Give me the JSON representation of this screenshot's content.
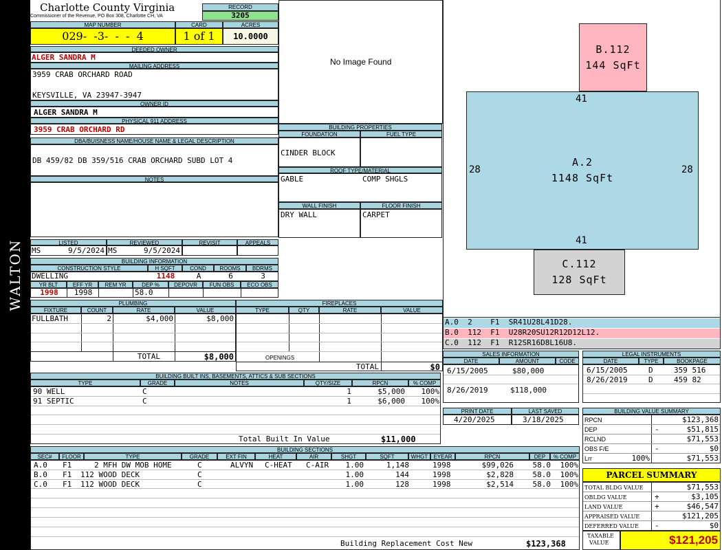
{
  "sidebar": {
    "district": "WALTON"
  },
  "header": {
    "county": "Charlotte County Virginia",
    "commissioner": "Commissioner of the Revenue, PO Box 308, Charlotte CH, VA",
    "record_label": "RECORD",
    "record": "3205",
    "map_label": "MAP NUMBER",
    "map_number": "029-  -3-  -  -  4",
    "card_label": "CARD",
    "card": "1 of 1",
    "acres_label": "ACRES",
    "acres": "10.0000"
  },
  "owner": {
    "deeded_label": "DEEDED OWNER",
    "deeded": "ALGER SANDRA M",
    "mailing_label": "MAILING ADDRESS",
    "addr1": "3959 CRAB ORCHARD ROAD",
    "addr2": "KEYSVILLE, VA 23947-3947",
    "owner_id_label": "OWNER ID",
    "owner_id": "ALGER SANDRA M",
    "phys_label": "PHYSICAL 911 ADDRESS",
    "phys": "3959 CRAB ORCHARD RD",
    "dba_label": "DBA/BUISNESS NAME/HOUSE NAME & LEGAL DESCRIPTION",
    "legal": "DB 459/82 DB 359/516 CRAB ORCHARD SUBD LOT 4",
    "notes_label": "NOTES"
  },
  "image": {
    "placeholder": "No Image Found"
  },
  "props": {
    "title": "BUILDING PROPERTIES",
    "foundation_label": "FOUNDATION",
    "fuel_label": "FUEL TYPE",
    "foundation": "CINDER BLOCK",
    "roof_label": "ROOF TYPE/MATERIAL",
    "roof_type": "GABLE",
    "roof_mat": "COMP SHGLS",
    "wall_label": "WALL FINISH",
    "floor_label": "FLOOR FINISH",
    "wall": "DRY WALL",
    "floor": "CARPET"
  },
  "listing": {
    "listed_label": "LISTED",
    "reviewed_label": "REVIEWED",
    "revisit_label": "REVISIT",
    "appeals_label": "APPEALS",
    "listed_by": "MS",
    "listed_date": "9/5/2024",
    "reviewed_by": "MS",
    "reviewed_date": "9/5/2024"
  },
  "bldg": {
    "title": "BUILDING INFORMATION",
    "style_label": "CONSTRUCTION STYLE",
    "hsqft_label": "H SQFT",
    "cond_label": "COND",
    "rooms_label": "ROOMS",
    "bdrms_label": "BDRMS",
    "style": "DWELLING",
    "hsqft": "1148",
    "cond": "A",
    "rooms": "6",
    "bdrms": "3",
    "yrblt_label": "YR BLT",
    "effyr_label": "EFF YR",
    "remyr_label": "REM YR",
    "dep_label": "DEP %",
    "depovr_label": "DEPOVR",
    "funobs_label": "FUN OBS",
    "ecoobs_label": "ECO OBS",
    "yrblt": "1998",
    "effyr": "1998",
    "dep": "58.0"
  },
  "plumbing": {
    "title": "PLUMBING",
    "h_fixture": "FIXTURE",
    "h_count": "COUNT",
    "h_rate": "RATE",
    "h_value": "VALUE",
    "fixture": "FULLBATH",
    "count": "2",
    "rate": "$4,000",
    "value": "$8,000",
    "total_label": "TOTAL",
    "total": "$8,000"
  },
  "fireplaces": {
    "title": "FIREPLACES",
    "h_type": "TYPE",
    "h_qty": "QTY",
    "h_rate": "RATE",
    "h_value": "VALUE",
    "openings_label": "OPENINGS",
    "total_label": "TOTAL",
    "total": "$0"
  },
  "builtins": {
    "title": "BUILDING BUILT INS, BASEMENTS, ATTICS & SUB SECTIONS",
    "h_type": "TYPE",
    "h_grade": "GRADE",
    "h_notes": "NOTES",
    "h_qty": "QTY/SIZE",
    "h_rpcn": "RPCN",
    "h_comp": "% COMP",
    "rows": [
      {
        "type": "90 WELL",
        "grade": "C",
        "qty": "1",
        "rpcn": "$5,000",
        "comp": "100%"
      },
      {
        "type": "91 SEPTIC",
        "grade": "C",
        "qty": "1",
        "rpcn": "$6,000",
        "comp": "100%"
      }
    ],
    "total_label": "Total Built In Value",
    "total": "$11,000"
  },
  "sections": {
    "title": "BUILDING SECTIONS",
    "h_sec": "SEC#",
    "h_floor": "FLOOR",
    "h_type": "TYPE",
    "h_grade": "GRADE",
    "h_extfin": "EXT FIN",
    "h_heat": "HEAT",
    "h_air": "AIR",
    "h_shgt": "SHGT",
    "h_sqft": "SQFT",
    "h_whgt": "WHGT",
    "h_eyear": "EYEAR",
    "h_rpcn": "RPCN",
    "h_dep": "DEP",
    "h_comp": "% COMP",
    "rows": [
      {
        "sec": "A.0",
        "floor": "F1",
        "type": "2 MFH DW MOB HOME",
        "grade": "C",
        "extfin": "ALVYN",
        "heat": "C-HEAT",
        "air": "C-AIR",
        "shgt": "1.00",
        "sqft": "1,148",
        "eyear": "1998",
        "rpcn": "$99,026",
        "dep": "58.0",
        "comp": "100%"
      },
      {
        "sec": "B.0",
        "floor": "F1",
        "type": "112 WOOD DECK",
        "grade": "C",
        "extfin": "",
        "heat": "",
        "air": "",
        "shgt": "1.00",
        "sqft": "144",
        "eyear": "1998",
        "rpcn": "$2,828",
        "dep": "58.0",
        "comp": "100%"
      },
      {
        "sec": "C.0",
        "floor": "F1",
        "type": "112 WOOD DECK",
        "grade": "C",
        "extfin": "",
        "heat": "",
        "air": "",
        "shgt": "1.00",
        "sqft": "128",
        "eyear": "1998",
        "rpcn": "$2,514",
        "dep": "58.0",
        "comp": "100%"
      }
    ],
    "rcn_label": "Building Replacement Cost New",
    "rcn": "$123,368"
  },
  "sketch": {
    "a_name": "A.2",
    "a_area": "1148 SqFt",
    "b_name": "B.112",
    "b_area": "144 SqFt",
    "c_name": "C.112",
    "c_area": "128 SqFt",
    "dim_top": "41",
    "dim_bottom": "41",
    "dim_left": "28",
    "dim_right": "28",
    "colors": {
      "a": "#add8e6",
      "b": "#ffb6c1",
      "c": "#d3d3d3"
    }
  },
  "sketch_codes": [
    {
      "text": "A.0  2    F1  SR41U28L41D28.",
      "color": "#add8e6"
    },
    {
      "text": "B.0  112  F1  U28R20SU12R12D12L12.",
      "color": "#ffb6c1"
    },
    {
      "text": "C.0  112  F1  R12SR16D8L16U8.",
      "color": "#d3d3d3"
    }
  ],
  "sales": {
    "title": "SALES INFORMATION",
    "h_date": "DATE",
    "h_amount": "AMOUNT",
    "h_code": "CODE",
    "rows": [
      {
        "date": "6/15/2005",
        "amount": "$80,000"
      },
      {
        "date": "8/26/2019",
        "amount": "$118,000"
      }
    ]
  },
  "legal": {
    "title": "LEGAL INSTRUMENTS",
    "h_date": "DATE",
    "h_type": "TYPE",
    "h_book": "BOOKPAGE",
    "rows": [
      {
        "date": "6/15/2005",
        "type": "D",
        "book": "359 516"
      },
      {
        "date": "8/26/2019",
        "type": "D",
        "book": "459 82"
      }
    ]
  },
  "print": {
    "print_label": "PRINT DATE",
    "saved_label": "LAST SAVED",
    "print_date": "4/20/2025",
    "last_saved": "3/18/2025"
  },
  "value_summary": {
    "title": "BUILDING VALUE SUMMARY",
    "rows": [
      {
        "label": "RPCN",
        "sign": "",
        "value": "$123,368"
      },
      {
        "label": "DEP",
        "sign": "-",
        "value": "$51,815"
      },
      {
        "label": "RCLND",
        "sign": "",
        "value": "$71,553"
      },
      {
        "label": "OBS F/E",
        "sign": "-",
        "value": "$0"
      },
      {
        "label": "Lrr",
        "pct": "100%",
        "sign": "",
        "value": "$71,553"
      }
    ]
  },
  "parcel": {
    "title": "PARCEL SUMMARY",
    "rows": [
      {
        "label": "TOTAL BLDG VALUE",
        "sign": "",
        "value": "$71,553"
      },
      {
        "label": "OBLDG VALUE",
        "sign": "+",
        "value": "$3,105"
      },
      {
        "label": "LAND VALUE",
        "sign": "+",
        "value": "$46,547"
      },
      {
        "label": "APPRAISED VALUE",
        "sign": "",
        "value": "$121,205"
      },
      {
        "label": "DEFERRED VALUE",
        "sign": "-",
        "value": "$0"
      }
    ],
    "taxable_label1": "TAXABLE",
    "taxable_label2": "VALUE",
    "taxable": "$121,205"
  }
}
